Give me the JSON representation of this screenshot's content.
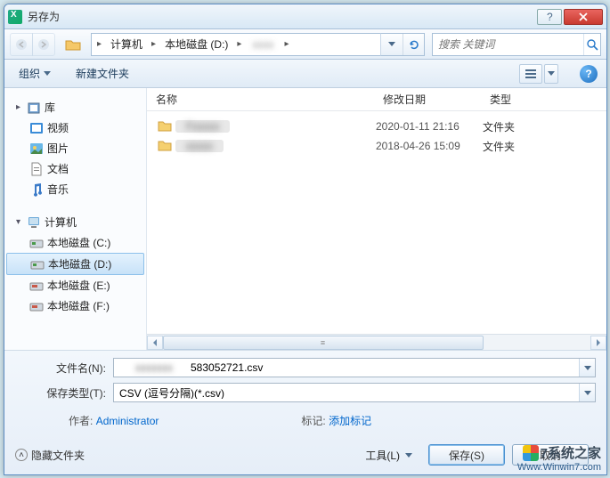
{
  "window": {
    "title": "另存为"
  },
  "nav": {
    "breadcrumb": [
      "计算机",
      "本地磁盘 (D:)"
    ],
    "search_placeholder": "搜索 关键词"
  },
  "toolbar": {
    "organize": "组织",
    "new_folder": "新建文件夹"
  },
  "sidebar": {
    "library_label": "库",
    "library_items": [
      "视频",
      "图片",
      "文档",
      "音乐"
    ],
    "computer_label": "计算机",
    "drives": [
      "本地磁盘 (C:)",
      "本地磁盘 (D:)",
      "本地磁盘 (E:)",
      "本地磁盘 (F:)"
    ]
  },
  "columns": {
    "name": "名称",
    "date": "修改日期",
    "type": "类型"
  },
  "files": [
    {
      "date": "2020-01-11 21:16",
      "type": "文件夹"
    },
    {
      "date": "2018-04-26 15:09",
      "type": "文件夹"
    }
  ],
  "form": {
    "filename_label": "文件名(N):",
    "filename_suffix": "583052721.csv",
    "filetype_label": "保存类型(T):",
    "filetype_value": "CSV (逗号分隔)(*.csv)",
    "author_label": "作者:",
    "author_value": "Administrator",
    "tags_label": "标记:",
    "tags_value": "添加标记"
  },
  "actions": {
    "hide_folders": "隐藏文件夹",
    "tools": "工具(L)",
    "save": "保存(S)",
    "cancel": "取消"
  },
  "watermark": {
    "brand": "7系统之家",
    "url": "Www.Winwin7.com"
  }
}
